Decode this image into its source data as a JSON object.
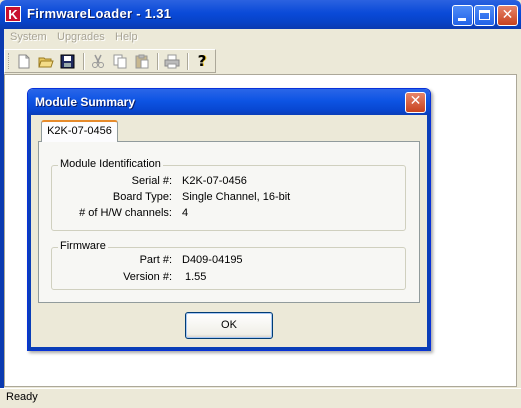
{
  "window": {
    "title": "FirmwareLoader - 1.31",
    "logo_letter": "K",
    "title_color": "#0a4ad8"
  },
  "menu": {
    "items": [
      "System",
      "Upgrades",
      "Help"
    ]
  },
  "toolbar": {
    "buttons": [
      "new-icon",
      "open-icon",
      "save-icon",
      "cut-icon",
      "copy-icon",
      "paste-icon",
      "print-icon",
      "help-icon"
    ],
    "help_glyph": "?"
  },
  "status": {
    "text": "Ready"
  },
  "dialog": {
    "title": "Module Summary",
    "tab_label": "K2K-07-0456",
    "close_glyph": "✕",
    "identification": {
      "group_title": "Module Identification",
      "serial_label": "Serial #:",
      "serial_value": "K2K-07-0456",
      "board_type_label": "Board Type:",
      "board_type_value": "Single Channel, 16-bit",
      "channels_label": "# of H/W channels:",
      "channels_value": "4"
    },
    "firmware": {
      "group_title": "Firmware",
      "part_label": "Part #:",
      "part_value": "D409-04195",
      "version_label": "Version #:",
      "version_value": "1.55"
    },
    "ok_label": "OK"
  }
}
